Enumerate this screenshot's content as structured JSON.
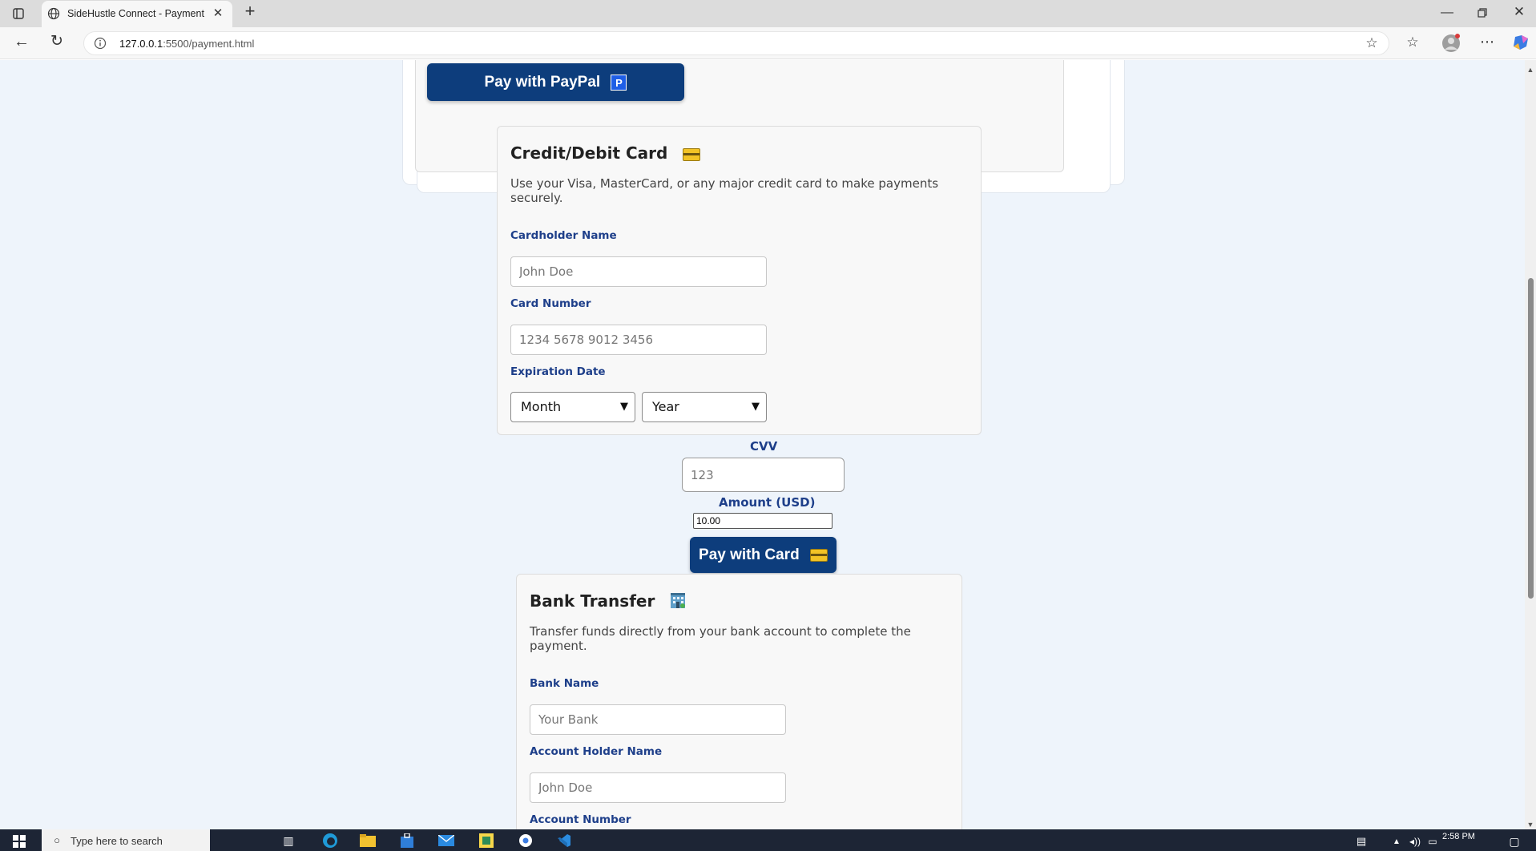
{
  "browser": {
    "tab_title": "SideHustle Connect - Payment",
    "url_host": "127.0.0.1",
    "url_rest": ":5500/payment.html"
  },
  "paypal": {
    "button_label": "Pay with PayPal",
    "badge": "P"
  },
  "card": {
    "title": "Credit/Debit Card",
    "description": "Use your Visa, MasterCard, or any major credit card to make payments securely.",
    "cardholder_label": "Cardholder Name",
    "cardholder_placeholder": "John Doe",
    "number_label": "Card Number",
    "number_placeholder": "1234 5678 9012 3456",
    "expiry_label": "Expiration Date",
    "month_value": "Month",
    "year_value": "Year",
    "cvv_label": "CVV",
    "cvv_placeholder": "123",
    "amount_label": "Amount (USD)",
    "amount_value": "10.00",
    "button_label": "Pay with Card"
  },
  "bank": {
    "title": "Bank Transfer",
    "description": "Transfer funds directly from your bank account to complete the payment.",
    "bank_name_label": "Bank Name",
    "bank_name_placeholder": "Your Bank",
    "holder_label": "Account Holder Name",
    "holder_placeholder": "John Doe",
    "account_number_label": "Account Number"
  },
  "taskbar": {
    "search_placeholder": "Type here to search",
    "time": "2:58 PM"
  }
}
